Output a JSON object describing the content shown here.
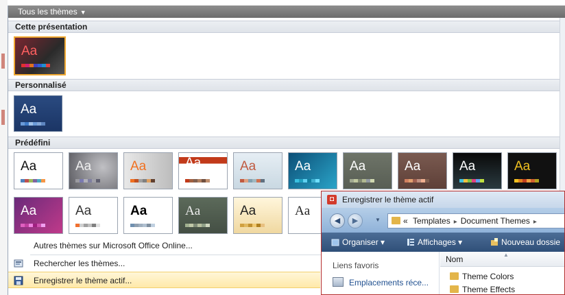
{
  "gallery": {
    "title": "Tous les thèmes",
    "sections": [
      {
        "label": "Cette présentation"
      },
      {
        "label": "Personnalisé"
      },
      {
        "label": "Prédéfini"
      }
    ],
    "theme_glyph": "Aa"
  },
  "menu": {
    "items": [
      {
        "label": "Autres thèmes sur Microsoft Office Online..."
      },
      {
        "label": "Rechercher les thèmes..."
      },
      {
        "label": "Enregistrer le thème actif..."
      }
    ]
  },
  "dialog": {
    "title": "Enregistrer le thème actif",
    "breadcrumb": [
      "«",
      "Templates",
      "Document Themes",
      "▸"
    ],
    "toolbar": [
      "Organiser",
      "Affichages",
      "Nouveau dossie"
    ],
    "favorites_label": "Liens favoris",
    "recent_label": "Emplacements réce...",
    "column_name": "Nom",
    "files": [
      "Theme Colors",
      "Theme Effects"
    ]
  },
  "colors": {
    "accent_highlight": "#ffe9a8",
    "dialog_border": "#b42c2c",
    "toolbar": "#2f4f78"
  },
  "icons": [
    "chevron-down-icon",
    "back-arrow-icon",
    "forward-arrow-icon",
    "folder-icon",
    "search-icon",
    "save-icon",
    "app-icon"
  ]
}
